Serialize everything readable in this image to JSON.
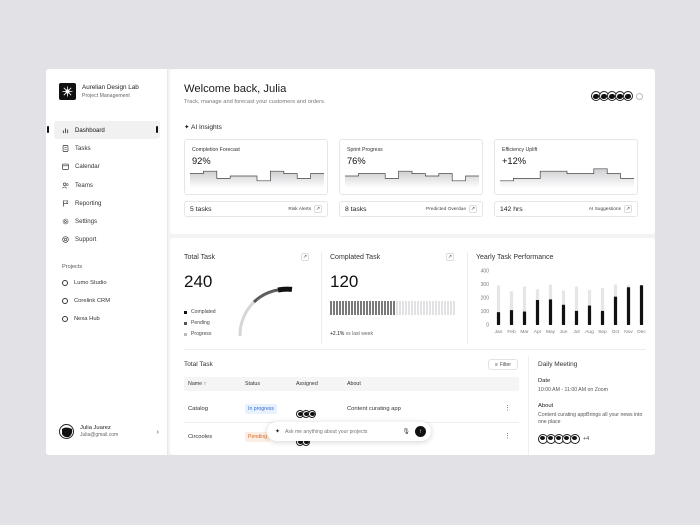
{
  "brand": {
    "name": "Aurelian Design Lab",
    "subtitle": "Project Management"
  },
  "nav": [
    {
      "label": "Dashboard",
      "icon": "bar-chart-icon"
    },
    {
      "label": "Tasks",
      "icon": "document-icon"
    },
    {
      "label": "Calendar",
      "icon": "calendar-icon"
    },
    {
      "label": "Teams",
      "icon": "users-icon"
    },
    {
      "label": "Reporting",
      "icon": "flag-icon"
    },
    {
      "label": "Settings",
      "icon": "gear-icon"
    },
    {
      "label": "Support",
      "icon": "headset-icon"
    }
  ],
  "projects": {
    "label": "Projects",
    "items": [
      "Lumo Studio",
      "Corelink CRM",
      "Nexa Hub"
    ]
  },
  "user": {
    "name": "Julia Juarez",
    "email": "Julia@gmail.com"
  },
  "header": {
    "title": "Welcome back, Julia",
    "subtitle": "Track, manage and forecast your customers and orders."
  },
  "ai_insights": {
    "title": "AI Insights",
    "cards": [
      {
        "title": "Completion Forecast",
        "value": "92%",
        "footer_value": "5 tasks",
        "footer_label": "Risk Alerts"
      },
      {
        "title": "Sprint Progress",
        "value": "76%",
        "footer_value": "8 tasks",
        "footer_label": "Predicted Overdue"
      },
      {
        "title": "Efficiency Uplift",
        "value": "+12%",
        "footer_value": "142 hrs",
        "footer_label": "AI Suggestions"
      }
    ]
  },
  "total_task": {
    "title": "Total Task",
    "value": "240",
    "legend": [
      "Complated",
      "Pending",
      "Progress"
    ]
  },
  "completed_task": {
    "title": "Complated Task",
    "value": "120",
    "delta": "+2.1%",
    "delta_label": "vs last week"
  },
  "chart_data": {
    "type": "bar",
    "title": "Yearly Task Performance",
    "categories": [
      "Jan",
      "Feb",
      "Mar",
      "Apr",
      "May",
      "Jun",
      "Jul",
      "Aug",
      "Sep",
      "Oct",
      "Nov",
      "Dec"
    ],
    "series": [
      {
        "values": [
          95,
          110,
          100,
          185,
          190,
          150,
          105,
          145,
          105,
          210,
          280,
          295
        ]
      },
      {
        "values": [
          295,
          250,
          285,
          265,
          300,
          255,
          285,
          260,
          275,
          300,
          295,
          295
        ]
      }
    ],
    "yticks": [
      0,
      100,
      200,
      300,
      400
    ],
    "ylim": [
      0,
      430
    ]
  },
  "table": {
    "title": "Total Task",
    "filter_label": "Filter",
    "headers": [
      "Name",
      "Status",
      "Assigned",
      "About"
    ],
    "rows": [
      {
        "name": "Catalog",
        "status": "In progress",
        "about": "Content curating app"
      },
      {
        "name": "Circooles",
        "status": "Pending",
        "about": ""
      }
    ]
  },
  "ask": {
    "placeholder": "Ask me anything about your projects"
  },
  "meeting": {
    "title": "Daily Meeting",
    "date_label": "Date",
    "date_value": "10:00 AM - 11:00 AM on Zoom",
    "about_label": "About",
    "about_text": "Content curating appBrings all your news into one place",
    "extra_count": "+4"
  },
  "colors": {
    "accent": "#111111",
    "in_progress_bg": "#e9f1fc",
    "in_progress_text": "#2f6bd6",
    "pending_bg": "#fdeee3",
    "pending_text": "#d76a2a"
  }
}
